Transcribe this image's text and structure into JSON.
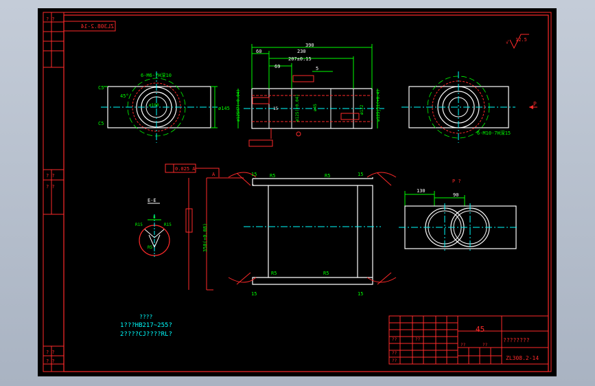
{
  "drawing": {
    "code_top": "ZL308.2-14",
    "code_block": "ZL308.2-14",
    "material": "45",
    "part_name": "????????",
    "roughness_corner": "12.5",
    "notes_title": "????",
    "notes": [
      "1???HB217~255?",
      "2????CJ????RL?"
    ],
    "side_marks": [
      "? ?",
      "? ?",
      "? ?",
      "? ?",
      "? ?"
    ],
    "front_dims": [
      "390",
      "60",
      "230",
      "207±0.15",
      "69",
      "5",
      "15"
    ],
    "front_bore": [
      "ø125H7(+0.04)",
      "ø125(+0.04)",
      "ø45",
      "ø122",
      "ø125j11(+0.4)"
    ],
    "left_view_label": "6-M6-7H深10",
    "right_view_label": "6-M10-7H深15",
    "view_arrow": "P",
    "left_dims": [
      "C5",
      "45°",
      "C5",
      "ø145",
      "ø100"
    ],
    "section_label": "E-E",
    "section_dims": [
      "R15",
      "8",
      "R15",
      "R5"
    ],
    "tolerance_frame": "0.025 A",
    "datum_a": "A",
    "center_dims": [
      "15",
      "R5",
      "15",
      "R5",
      "15",
      "15",
      "R5",
      "R5"
    ],
    "side_dim": "350(+0.08)",
    "pview_title": "P ?",
    "pview_dims": [
      "130",
      "90"
    ],
    "titleblock_cells": [
      "??",
      "??",
      "??",
      "??",
      "??",
      "??"
    ]
  }
}
